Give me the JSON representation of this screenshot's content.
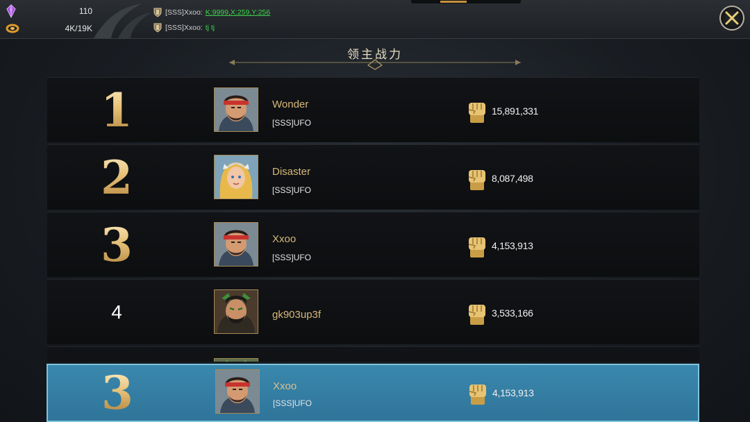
{
  "resources": [
    {
      "icon": "purple-gem-icon",
      "value": "110"
    },
    {
      "icon": "gold-ring-icon",
      "value": "4K/19K"
    }
  ],
  "chat": [
    {
      "sender": "[SSS]Xxoo:",
      "message": "K:9999,X:259,Y:256",
      "link": true
    },
    {
      "sender": "[SSS]Xxoo:",
      "message": "tj tj",
      "link": false
    }
  ],
  "title": "领主战力",
  "rankings": [
    {
      "rank": "1",
      "name": "Wonder",
      "guild": "[SSS]UFO",
      "power": "15,891,331",
      "avatar": "bandana-warrior"
    },
    {
      "rank": "2",
      "name": "Disaster",
      "guild": "[SSS]UFO",
      "power": "8,087,498",
      "avatar": "blonde-valkyrie"
    },
    {
      "rank": "3",
      "name": "Xxoo",
      "guild": "[SSS]UFO",
      "power": "4,153,913",
      "avatar": "bandana-warrior"
    },
    {
      "rank": "4",
      "name": "gk903up3f",
      "guild": "",
      "power": "3,533,166",
      "avatar": "green-orc"
    }
  ],
  "self": {
    "rank": "3",
    "name": "Xxoo",
    "guild": "[SSS]UFO",
    "power": "4,153,913",
    "avatar": "bandana-warrior"
  },
  "colors": {
    "gold": "#d8b978",
    "chat_green": "#3ed64d",
    "highlight": "#3a88ad"
  }
}
